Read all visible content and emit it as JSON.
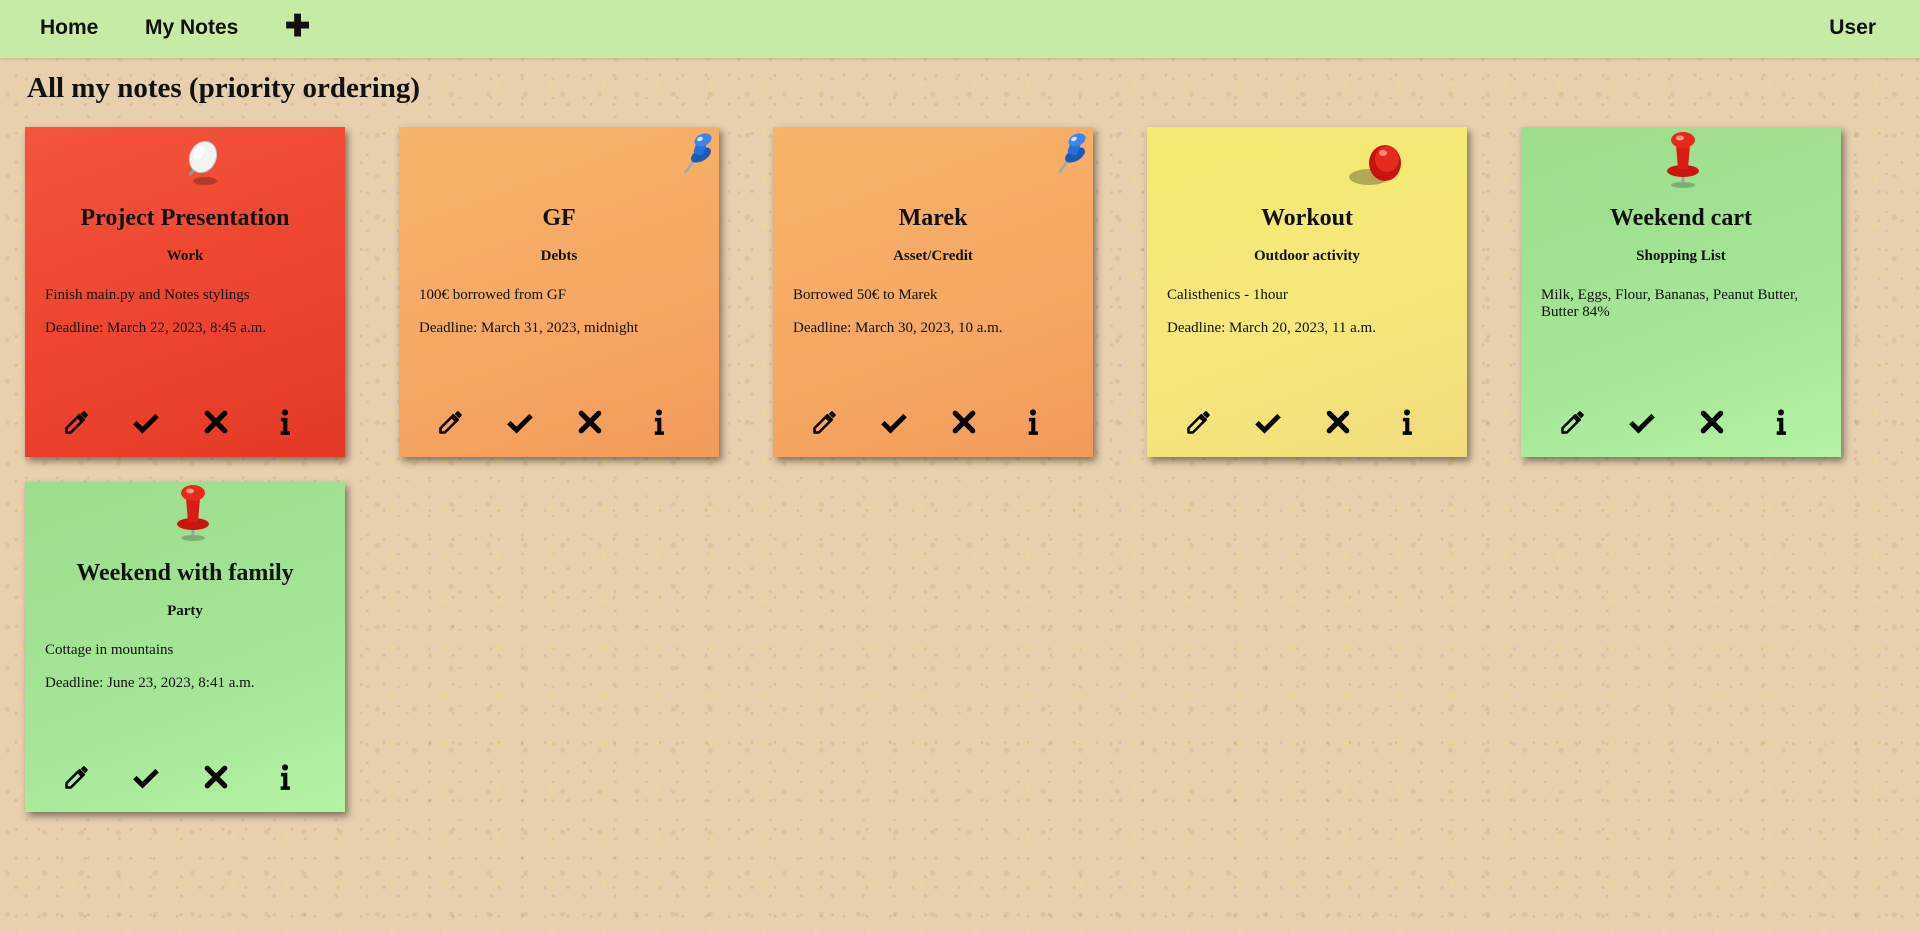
{
  "nav": {
    "home": "Home",
    "my_notes": "My Notes",
    "add": "✚",
    "user": "User"
  },
  "page": {
    "title": "All my notes (priority ordering)"
  },
  "notes": [
    {
      "title": "Project Presentation",
      "category": "Work",
      "text": "Finish main.py and Notes stylings",
      "deadline": "Deadline: March 22, 2023, 8:45 a.m.",
      "color": "#ee4630",
      "pin": "white-pushpin-icon"
    },
    {
      "title": "GF",
      "category": "Debts",
      "text": "100€ borrowed from GF",
      "deadline": "Deadline: March 31, 2023, midnight",
      "color": "#f5a863",
      "pin": "blue-pushpin-icon"
    },
    {
      "title": "Marek",
      "category": "Asset/Credit",
      "text": "Borrowed 50€ to Marek",
      "deadline": "Deadline: March 30, 2023, 10 a.m.",
      "color": "#f5a863",
      "pin": "blue-pushpin-icon"
    },
    {
      "title": "Workout",
      "category": "Outdoor activity",
      "text": "Calisthenics - 1hour",
      "deadline": "Deadline: March 20, 2023, 11 a.m.",
      "color": "#f6e87a",
      "pin": "red-pushpin-icon"
    },
    {
      "title": "Weekend cart",
      "category": "Shopping List",
      "text": "Milk, Eggs, Flour, Bananas, Peanut Butter, Butter 84%",
      "deadline": "",
      "color": "#a5e597",
      "pin": "red-pushpin-icon"
    },
    {
      "title": "Weekend with family",
      "category": "Party",
      "text": "Cottage in mountains",
      "deadline": "Deadline: June 23, 2023, 8:41 a.m.",
      "color": "#a5e597",
      "pin": "red-pushpin-icon"
    }
  ],
  "note_actions": [
    "pencil-icon",
    "checkmark-icon",
    "close-icon",
    "info-icon"
  ],
  "colors": {
    "navbar": "#c7eba5",
    "board": "#e8cfae"
  }
}
